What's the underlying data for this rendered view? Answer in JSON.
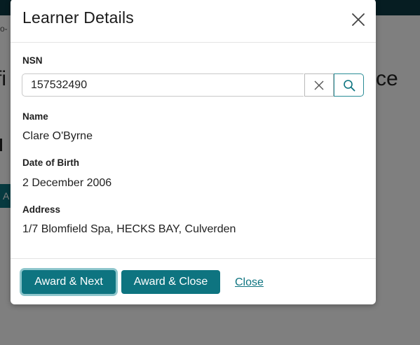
{
  "background": {
    "breadcrumb_fragment": "ro-",
    "heading_left_fragment": "fi",
    "heading_right_fragment": "ce",
    "button_fragment": "A"
  },
  "modal": {
    "title": "Learner Details",
    "close_icon": "close-icon",
    "nsn": {
      "label": "NSN",
      "value": "157532490",
      "clear_icon": "clear-x-icon",
      "search_icon": "search-icon"
    },
    "name": {
      "label": "Name",
      "value": "Clare O'Byrne"
    },
    "dob": {
      "label": "Date of Birth",
      "value": "2 December 2006"
    },
    "address": {
      "label": "Address",
      "value": "1/7 Blomfield Spa, HECKS BAY, Culverden"
    },
    "footer": {
      "award_next_label": "Award & Next",
      "award_close_label": "Award & Close",
      "close_label": "Close"
    }
  },
  "colors": {
    "accent": "#0e7480",
    "topbar": "#0c3a44",
    "focus_ring": "#8ec6cc"
  }
}
